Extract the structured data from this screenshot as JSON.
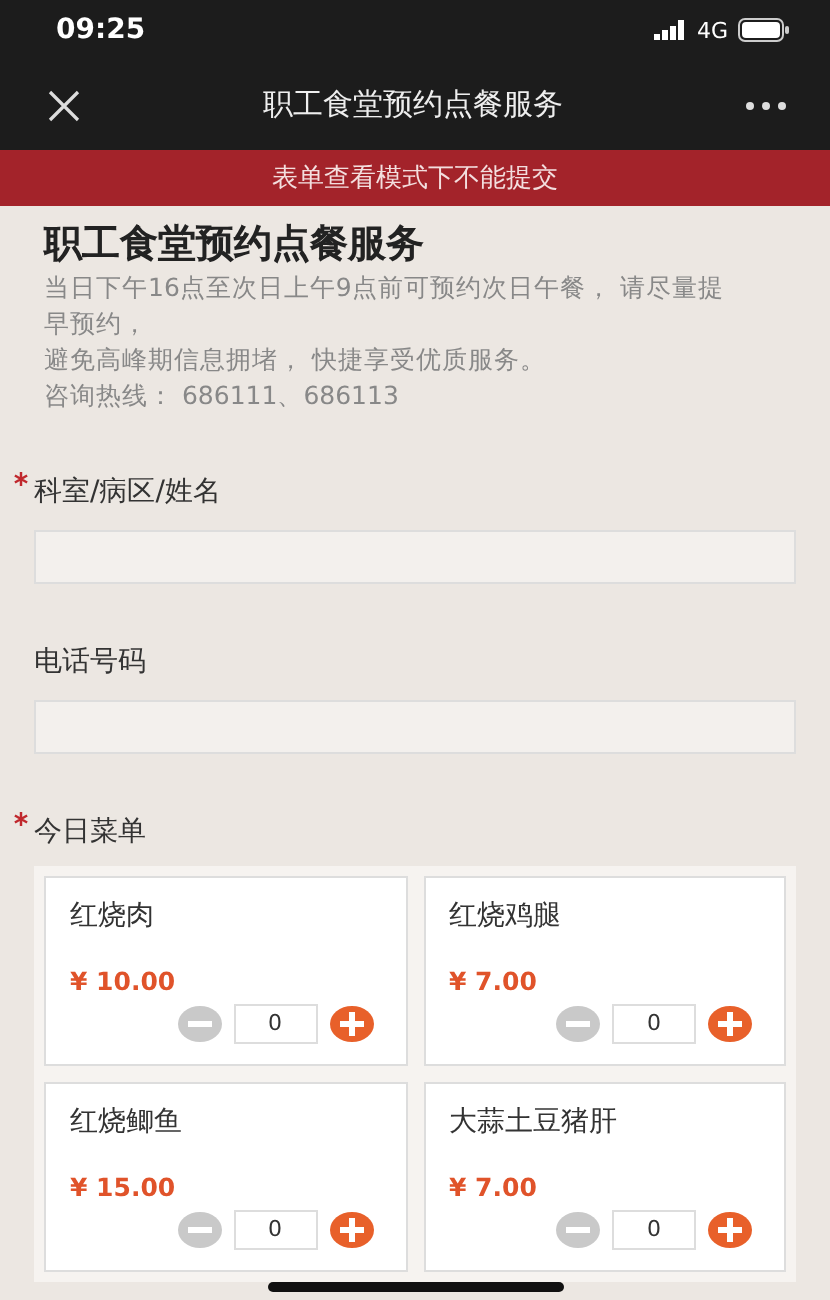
{
  "status_bar": {
    "time": "09:25",
    "network": "4G"
  },
  "nav_bar": {
    "title": "职工食堂预约点餐服务"
  },
  "banner": "表单查看模式下不能提交",
  "form": {
    "title": "职工食堂预约点餐服务",
    "description": [
      "当日下午16点至次日上午9点前可预约次日午餐， 请尽量提早预约，",
      "避免高峰期信息拥堵， 快捷享受优质服务。",
      "咨询热线： 686111、686113"
    ],
    "fields": [
      {
        "label": "科室/病区/姓名",
        "required": true
      },
      {
        "label": "电话号码",
        "required": false
      }
    ],
    "menu": {
      "label": "今日菜单",
      "required": true,
      "items": [
        {
          "name": "红烧肉",
          "price": "¥ 10.00",
          "quantity": "0"
        },
        {
          "name": "红烧鸡腿",
          "price": "¥ 7.00",
          "quantity": "0"
        },
        {
          "name": "红烧鲫鱼",
          "price": "¥ 15.00",
          "quantity": "0"
        },
        {
          "name": "大蒜土豆猪肝",
          "price": "¥ 7.00",
          "quantity": "0"
        }
      ]
    }
  }
}
